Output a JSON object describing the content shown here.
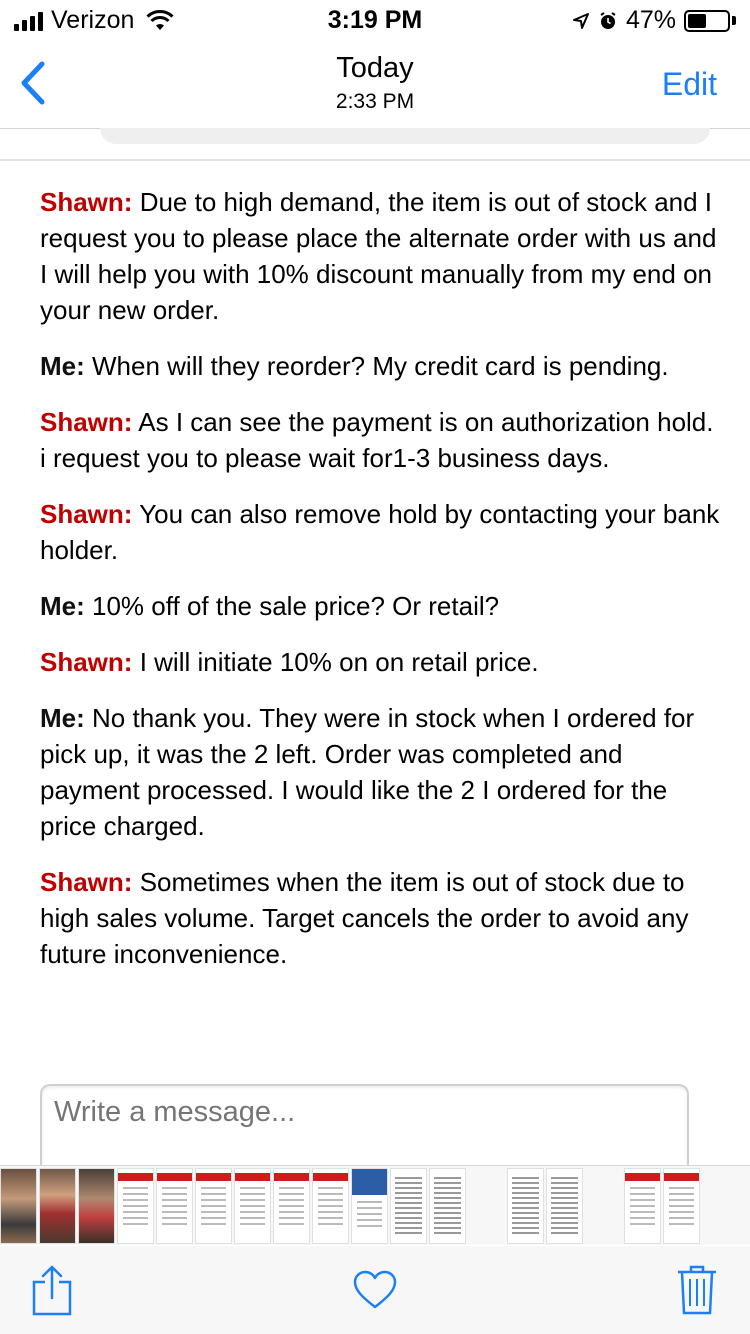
{
  "status_bar": {
    "carrier": "Verizon",
    "time": "3:19 PM",
    "battery_percent": "47%",
    "battery_level": 0.47
  },
  "nav": {
    "back_icon": "chevron-left-icon",
    "title": "Today",
    "subtitle": "2:33 PM",
    "edit_label": "Edit",
    "accent_color": "#1b80f5"
  },
  "transcript": {
    "agent_color": "#c00000",
    "messages": [
      {
        "speaker": "Shawn:",
        "role": "agent",
        "text": "Due to high demand, the item is out of stock and I request you to please place the alternate order with us and I will help you with 10% discount manually from my end on your new order."
      },
      {
        "speaker": "Me:",
        "role": "me",
        "text": "When will they reorder? My credit card is pending."
      },
      {
        "speaker": "Shawn:",
        "role": "agent",
        "text": "As I can see the payment is on authorization hold. i request you to please wait for1-3 business days."
      },
      {
        "speaker": "Shawn:",
        "role": "agent",
        "text": "You can also remove hold by contacting your bank holder."
      },
      {
        "speaker": "Me:",
        "role": "me",
        "text": "10% off of the sale price? Or retail?"
      },
      {
        "speaker": "Shawn:",
        "role": "agent",
        "text": "I will initiate 10% on on retail price."
      },
      {
        "speaker": "Me:",
        "role": "me",
        "text": "No thank you. They were in stock when I ordered for pick up, it was the 2 left. Order was completed and payment processed. I would like the 2 I ordered for the price charged."
      },
      {
        "speaker": "Shawn:",
        "role": "agent",
        "text": "Sometimes when the item is out of stock due to high sales volume. Target cancels the order to avoid any future inconvenience."
      }
    ]
  },
  "compose": {
    "placeholder": "Write a message..."
  },
  "thumbnails": [
    "photo1",
    "photo2",
    "photo3",
    "red",
    "red",
    "red",
    "red",
    "red",
    "red",
    "blue",
    "text",
    "text",
    "blank",
    "text",
    "text",
    "blank",
    "red",
    "red"
  ],
  "toolbar": {
    "share_icon": "share-icon",
    "favorite_icon": "heart-icon",
    "delete_icon": "trash-icon",
    "icon_color": "#1b80f5"
  }
}
